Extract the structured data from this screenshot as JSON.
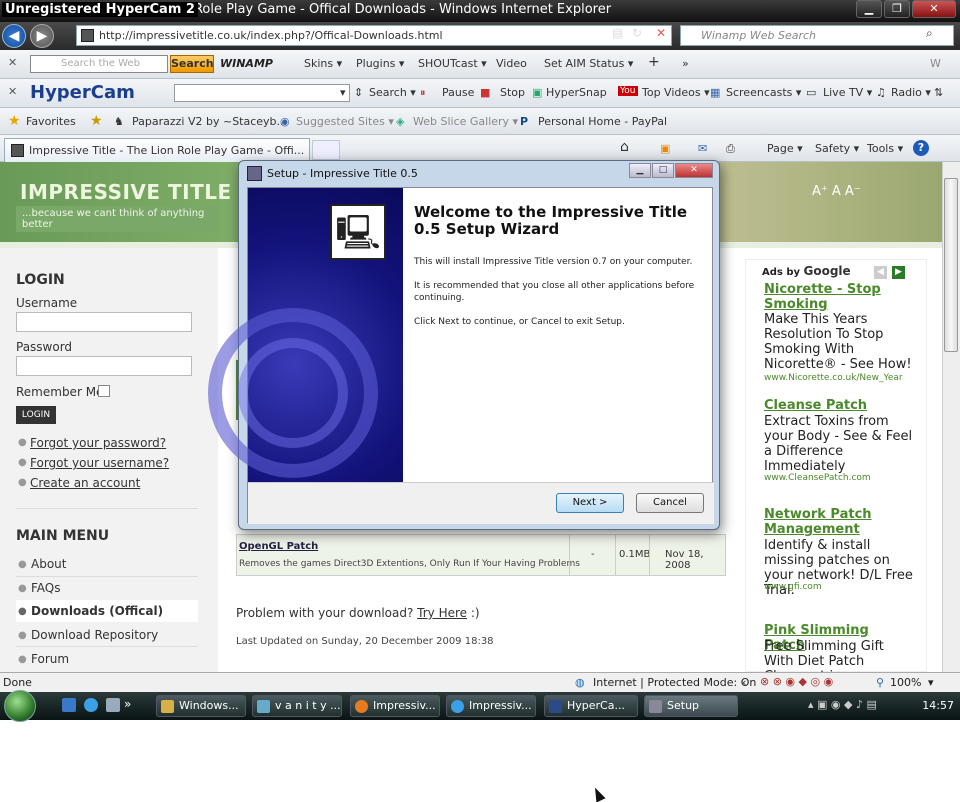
{
  "window": {
    "title": "Unregistered HyperCam 2",
    "title_rest": "Role Play Game - Offical Downloads - Windows Internet Explorer"
  },
  "address": {
    "url": "http://impressivetitle.co.uk/index.php?/Offical-Downloads.html",
    "search_placeholder": "Winamp Web Search"
  },
  "toolbar1": {
    "search_placeholder": "Search the Web",
    "search_button": "Search",
    "winamp_logo": "WINAMP",
    "items": [
      "Skins ▾",
      "Plugins ▾",
      "SHOUTcast ▾",
      "Video",
      "Set AIM Status ▾"
    ],
    "right_letter": "W"
  },
  "toolbar2": {
    "logo": "HyperCam",
    "items": [
      "Search ▾",
      "Pause",
      "Stop",
      "HyperSnap",
      "Top Videos ▾",
      "Screencasts ▾",
      "Live TV ▾",
      "Radio ▾"
    ]
  },
  "favbar": {
    "favorites": "Favorites",
    "items": [
      "Paparazzi V2 by ~Staceyb...",
      "Suggested Sites ▾",
      "Web Slice Gallery ▾",
      "Personal Home - PayPal"
    ]
  },
  "tabs": {
    "active": "Impressive Title - The Lion Role Play Game - Offi...",
    "tools": [
      "Page ▾",
      "Safety ▾",
      "Tools ▾"
    ]
  },
  "site": {
    "title": "IMPRESSIVE TITLE",
    "tagline": "...because we cant think of anything better",
    "font_controls": "A⁺ A A⁻"
  },
  "login": {
    "heading": "LOGIN",
    "username_label": "Username",
    "password_label": "Password",
    "remember_label": "Remember Me",
    "button": "LOGIN",
    "links": [
      "Forgot your password?",
      "Forgot your username?",
      "Create an account"
    ]
  },
  "menu": {
    "heading": "MAIN MENU",
    "items": [
      "About",
      "FAQs",
      "Downloads (Offical)",
      "Download Repository",
      "Forum"
    ],
    "active_index": 2
  },
  "downloads": {
    "row": {
      "name": "OpenGL Patch",
      "desc": "Removes the games Direct3D Extentions, Only Run If Your Having Problems",
      "col2": "-",
      "size": "0.1MB",
      "date": "Nov 18, 2008"
    },
    "problem_text": "Problem with your download?",
    "problem_link": "Try Here",
    "problem_tail": " :)",
    "last_updated": "Last Updated on Sunday, 20 December 2009 18:38"
  },
  "ads": {
    "header": "Ads by",
    "header_brand": "Google",
    "items": [
      {
        "title": "Nicorette - Stop Smoking",
        "text": "Make This Years Resolution To Stop Smoking With Nicorette® - See How!",
        "url": "www.Nicorette.co.uk/New_Year"
      },
      {
        "title": "Cleanse Patch",
        "text": "Extract Toxins from your Body - See & Feel a Difference Immediately",
        "url": "www.CleansePatch.com"
      },
      {
        "title": "Network Patch Management",
        "text": "Identify & install missing patches on your network! D/L Free Trial.",
        "url": "www.gfi.com"
      },
      {
        "title": "Pink Slimming Patch",
        "text": "Free Slimming Gift With Diet Patch Cheapest in",
        "url": ""
      }
    ]
  },
  "dialog": {
    "title": "Setup - Impressive Title 0.5",
    "heading": "Welcome to the Impressive Title 0.5 Setup Wizard",
    "para1": "This will install Impressive Title version 0.7 on your computer.",
    "para2": "It is recommended that you close all other applications before continuing.",
    "para3": "Click Next to continue, or Cancel to exit Setup.",
    "next": "Next >",
    "cancel": "Cancel"
  },
  "status": {
    "left": "Done",
    "zone": "Internet | Protected Mode: On",
    "zoom": "100%"
  },
  "taskbar": {
    "buttons": [
      "Windows...",
      "v a n i t y ...",
      "Impressiv...",
      "Impressiv...",
      "HyperCa...",
      "Setup"
    ],
    "clock": "14:57"
  }
}
